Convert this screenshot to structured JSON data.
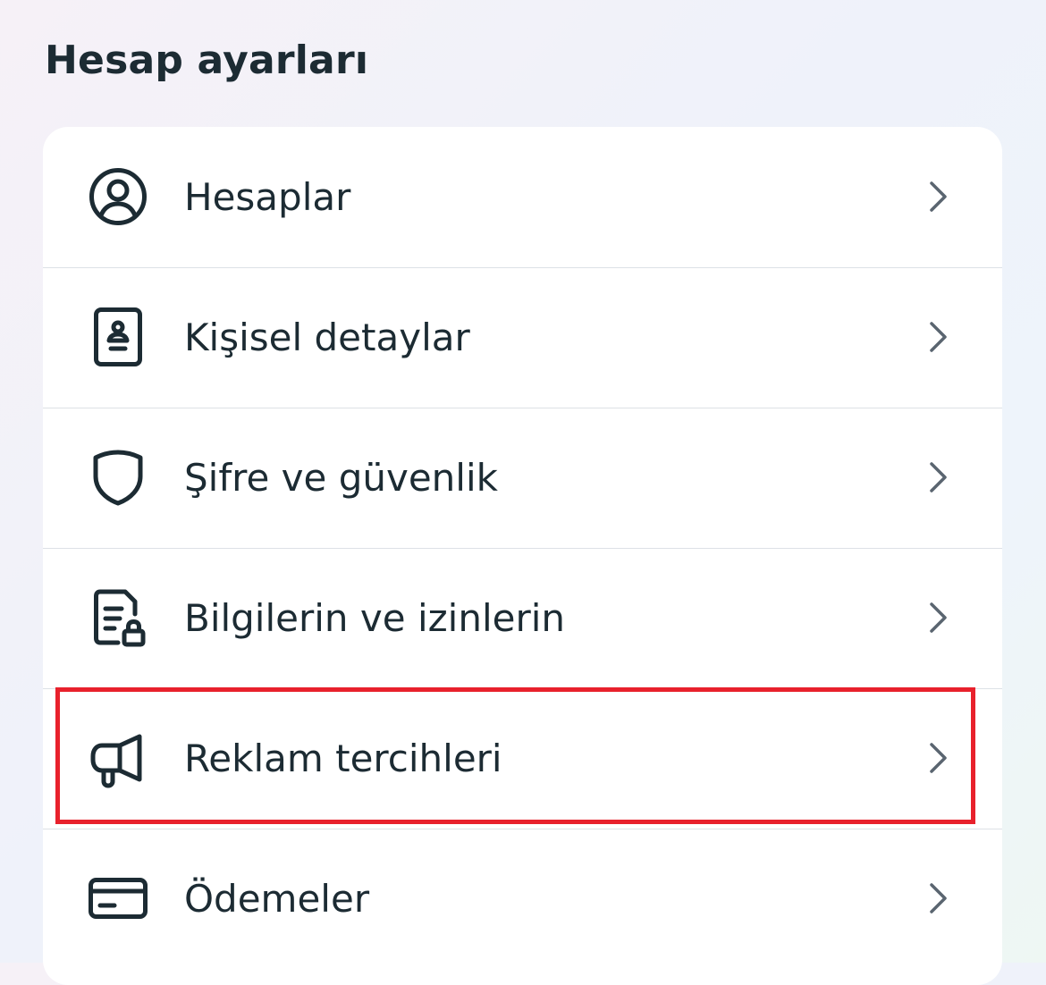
{
  "page": {
    "title": "Hesap ayarları"
  },
  "menu": {
    "items": [
      {
        "label": "Hesaplar",
        "icon": "account-circle-icon"
      },
      {
        "label": "Kişisel detaylar",
        "icon": "id-card-icon"
      },
      {
        "label": "Şifre ve güvenlik",
        "icon": "shield-icon"
      },
      {
        "label": "Bilgilerin ve izinlerin",
        "icon": "document-lock-icon"
      },
      {
        "label": "Reklam tercihleri",
        "icon": "megaphone-icon"
      },
      {
        "label": "Ödemeler",
        "icon": "credit-card-icon"
      }
    ],
    "chevron_icon": "chevron-right-icon"
  },
  "highlight": {
    "target": "Reklam tercihleri",
    "color": "#e8212c"
  },
  "colors": {
    "text": "#1c2b33",
    "divider": "#dde1e6",
    "chevron": "#5a6570"
  }
}
